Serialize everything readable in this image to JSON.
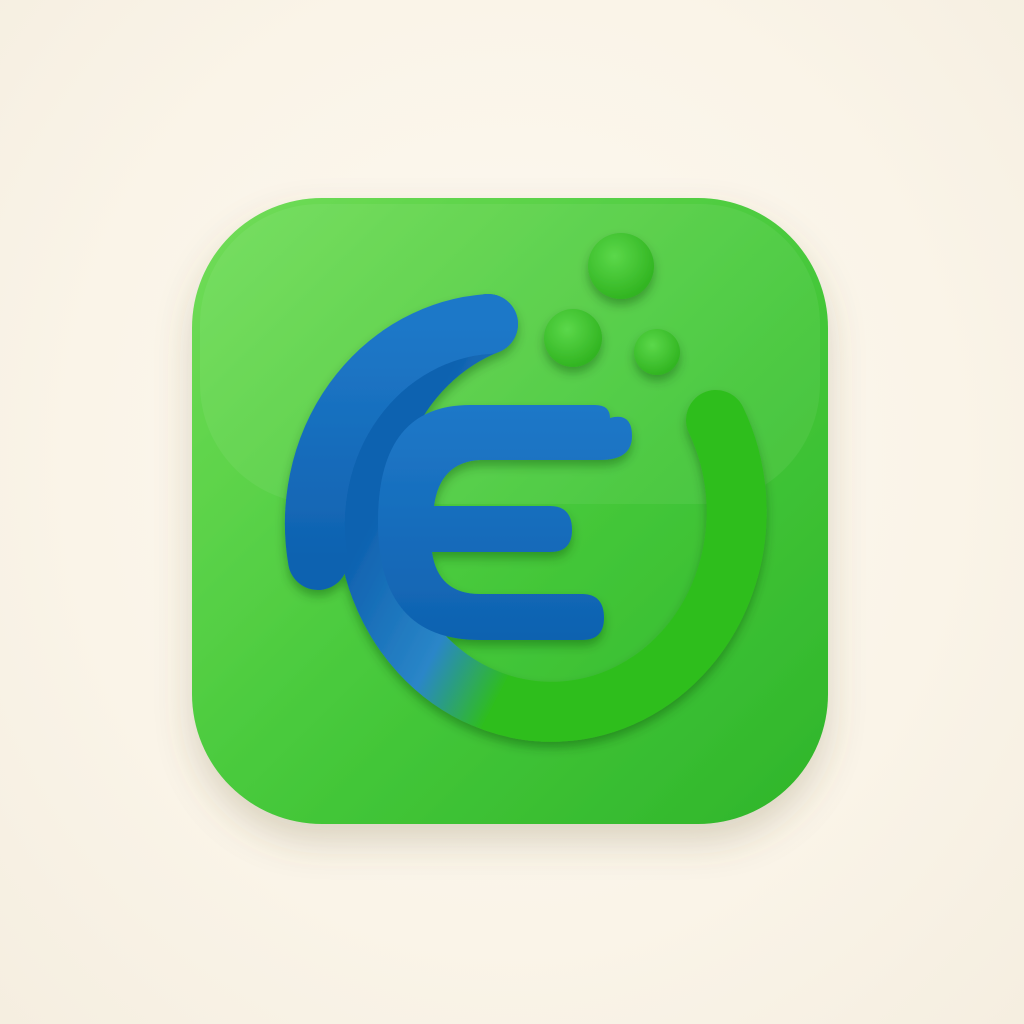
{
  "scene": {
    "background_color": "#faf4e8"
  },
  "app_icon": {
    "glyph": "E",
    "colors": {
      "tile_light": "#72dd58",
      "tile_mid": "#45c83a",
      "tile_dark": "#2fb52a",
      "blue_light": "#1e78c8",
      "blue": "#0f62b0",
      "blue_dark": "#0a4f94",
      "green_ring": "#2fbe1c",
      "dot_green": "#3cc22a"
    },
    "icons": {
      "main_mark": "letter-e-ring-icon",
      "decoration": "bubble-dots-icon"
    }
  }
}
